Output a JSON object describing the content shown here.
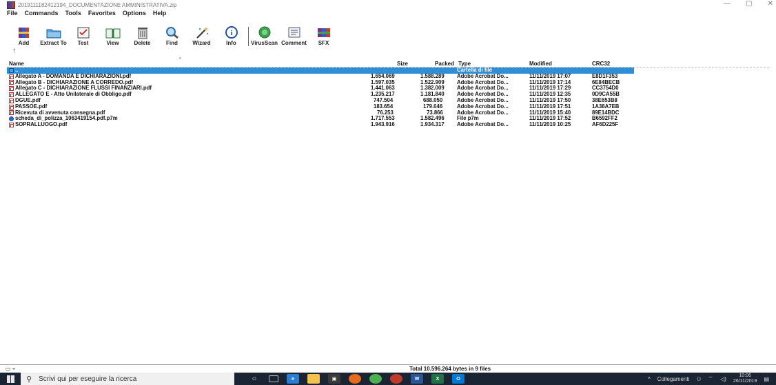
{
  "window": {
    "title": "2019111182412194_DOCUMENTAZIONE AMMINISTRATIVA.zip",
    "controls": [
      "—",
      "▢",
      "✕"
    ]
  },
  "menu": [
    "File",
    "Commands",
    "Tools",
    "Favorites",
    "Options",
    "Help"
  ],
  "toolbar": [
    {
      "label": "Add",
      "icon": "add-archive-icon"
    },
    {
      "label": "Extract To",
      "icon": "extract-folder-icon"
    },
    {
      "label": "Test",
      "icon": "test-icon"
    },
    {
      "label": "View",
      "icon": "view-book-icon"
    },
    {
      "label": "Delete",
      "icon": "trash-icon"
    },
    {
      "label": "Find",
      "icon": "magnifier-icon"
    },
    {
      "label": "Wizard",
      "icon": "wand-icon"
    },
    {
      "label": "Info",
      "icon": "info-icon"
    },
    {
      "label": "VirusScan",
      "icon": "virus-scan-icon"
    },
    {
      "label": "Comment",
      "icon": "comment-icon"
    },
    {
      "label": "SFX",
      "icon": "sfx-icon"
    }
  ],
  "columns": {
    "name": "Name",
    "size": "Size",
    "packed": "Packed",
    "type": "Type",
    "modified": "Modified",
    "crc": "CRC32"
  },
  "files": [
    {
      "name": "..",
      "size": "",
      "packed": "",
      "type": "Cartella di file",
      "modified": "",
      "crc": "",
      "icon": "folder"
    },
    {
      "name": "Allegato A - DOMANDA E DICHIARAZIONI.pdf",
      "size": "1.654.069",
      "packed": "1.588.289",
      "type": "Adobe Acrobat Do...",
      "modified": "11/11/2019 17:07",
      "crc": "E8D1F353",
      "icon": "pdf"
    },
    {
      "name": "Allegato B - DICHIARAZIONE A CORREDO.pdf",
      "size": "1.597.035",
      "packed": "1.522.909",
      "type": "Adobe Acrobat Do...",
      "modified": "11/11/2019 17:14",
      "crc": "6E84BECB",
      "icon": "pdf"
    },
    {
      "name": "Allegato C - DICHIARAZIONE FLUSSI FINANZIARI.pdf",
      "size": "1.441.063",
      "packed": "1.382.009",
      "type": "Adobe Acrobat Do...",
      "modified": "11/11/2019 17:29",
      "crc": "CC3754D0",
      "icon": "pdf"
    },
    {
      "name": "ALLEGATO E - Atto Unilaterale di Obbligo.pdf",
      "size": "1.235.217",
      "packed": "1.181.840",
      "type": "Adobe Acrobat Do...",
      "modified": "11/11/2019 12:35",
      "crc": "0D9CA55B",
      "icon": "pdf"
    },
    {
      "name": "DGUE.pdf",
      "size": "747.504",
      "packed": "688.050",
      "type": "Adobe Acrobat Do...",
      "modified": "11/11/2019 17:50",
      "crc": "38E653B8",
      "icon": "pdf"
    },
    {
      "name": "PASSOE.pdf",
      "size": "183.654",
      "packed": "179.046",
      "type": "Adobe Acrobat Do...",
      "modified": "11/11/2019 17:51",
      "crc": "1A38A7EB",
      "icon": "pdf"
    },
    {
      "name": "Ricevuta di avvenuta consegna.pdf",
      "size": "76.253",
      "packed": "73.866",
      "type": "Adobe Acrobat Do...",
      "modified": "11/11/2019 15:40",
      "crc": "89E14BDC",
      "icon": "pdf"
    },
    {
      "name": "scheda_di_polizza_1063419154.pdf.p7m",
      "size": "1.717.553",
      "packed": "1.582.496",
      "type": "File p7m",
      "modified": "11/11/2019 17:52",
      "crc": "B6592FF2",
      "icon": "p7m"
    },
    {
      "name": "SOPRALLUOGO.pdf",
      "size": "1.943.916",
      "packed": "1.934.317",
      "type": "Adobe Acrobat Do...",
      "modified": "11/11/2019 10:25",
      "crc": "AF6D225F",
      "icon": "pdf"
    }
  ],
  "status": {
    "text": "Total 10.596.264 bytes in 9 files"
  },
  "taskbar": {
    "search_placeholder": "Scrivi qui per eseguire la ricerca",
    "tray_label": "Collegamenti",
    "clock_time": "10:06",
    "clock_date": "26/11/2019"
  }
}
